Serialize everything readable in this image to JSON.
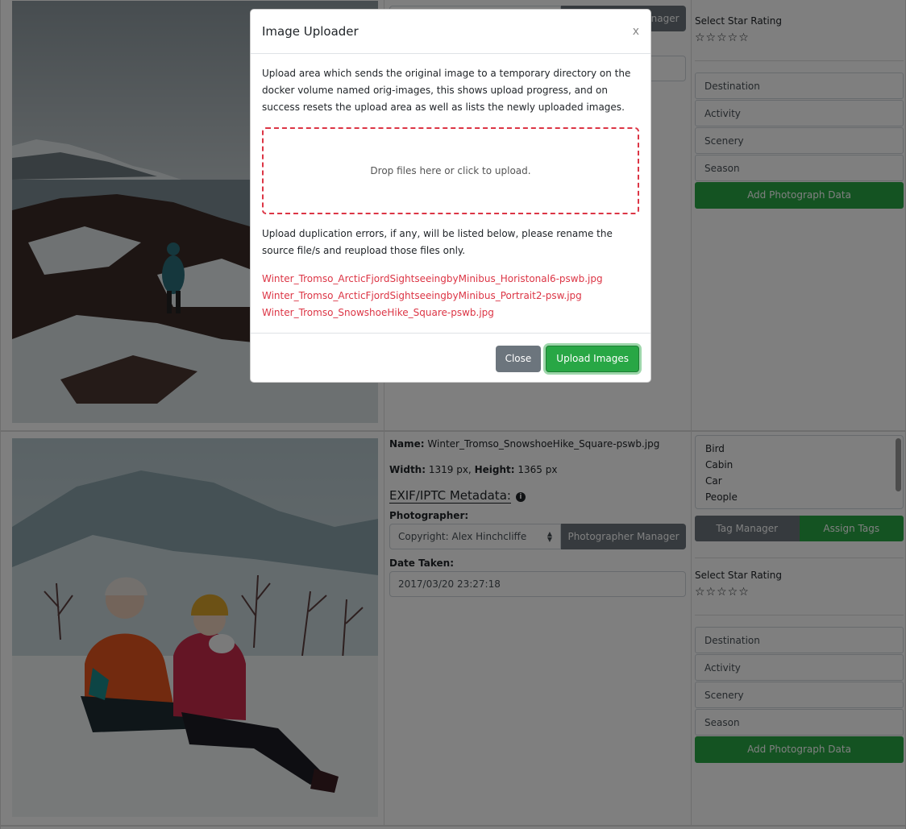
{
  "rows": [
    {
      "photographer_btn": "Photographer Manager",
      "star_title": "Select Star Rating",
      "stars": "☆☆☆☆☆",
      "fields": [
        "Destination",
        "Activity",
        "Scenery",
        "Season"
      ],
      "add_btn": "Add Photograph Data"
    },
    {
      "name_label": "Name:",
      "name": "Winter_Tromso_SnowshoeHike_Square-pswb.jpg",
      "width_label": "Width:",
      "width": "1319 px,",
      "height_label": "Height:",
      "height": "1365 px",
      "exif_title": "EXIF/IPTC Metadata:",
      "info_icon": "i",
      "photographer_label": "Photographer:",
      "photographer_value": "Copyright: Alex Hinchcliffe",
      "photographer_btn": "Photographer Manager",
      "date_label": "Date Taken:",
      "date_value": "2017/03/20 23:27:18",
      "tags": [
        "Bird",
        "Cabin",
        "Car",
        "People"
      ],
      "tag_manager_btn": "Tag Manager",
      "assign_tags_btn": "Assign Tags",
      "star_title": "Select Star Rating",
      "stars": "☆☆☆☆☆",
      "fields": [
        "Destination",
        "Activity",
        "Scenery",
        "Season"
      ],
      "add_btn": "Add Photograph Data"
    }
  ],
  "modal": {
    "title": "Image Uploader",
    "close_x": "x",
    "description": "Upload area which sends the original image to a temporary directory on the docker volume named orig-images, this shows upload progress, and on success resets the upload area as well as lists the newly uploaded images.",
    "dropzone_text": "Drop files here or click to upload.",
    "dup_note": "Upload duplication errors, if any, will be listed below, please rename the source file/s and reupload those files only.",
    "errors": [
      "Winter_Tromso_ArcticFjordSightseeingbyMinibus_Horistonal6-pswb.jpg",
      "Winter_Tromso_ArcticFjordSightseeingbyMinibus_Portrait2-psw.jpg",
      "Winter_Tromso_SnowshoeHike_Square-pswb.jpg"
    ],
    "close_btn": "Close",
    "upload_btn": "Upload Images"
  },
  "colors": {
    "accent_green": "#28a745",
    "grey_button": "#6c757d",
    "error_red": "#dc3545"
  }
}
